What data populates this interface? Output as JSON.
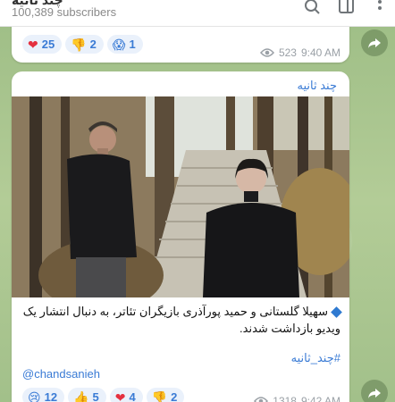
{
  "header": {
    "title": "چند ثانیه",
    "subscribers": "100,389 subscribers"
  },
  "post1": {
    "reactions": [
      {
        "emoji": "❤",
        "count": "25"
      },
      {
        "emoji": "👎",
        "count": "2"
      },
      {
        "emoji": "😱",
        "count": "1"
      }
    ],
    "views": "523",
    "time": "9:40 AM"
  },
  "post2": {
    "channel": "چند ثانیه",
    "caption": "سهیلا گلستانی و حمید پورآذری بازیگران تئاتر، به دنبال انتشار یک ویدیو بازداشت شدند.",
    "hashtag": "#چند_ثانیه",
    "handle": "@chandsanieh",
    "reactions": [
      {
        "emoji": "😢",
        "count": "12"
      },
      {
        "emoji": "👍",
        "count": "5"
      },
      {
        "emoji": "❤",
        "count": "4"
      },
      {
        "emoji": "👎",
        "count": "2"
      }
    ],
    "views": "1318",
    "time": "9:42 AM"
  },
  "icons": {
    "search": "search-icon",
    "columns": "sidebar-toggle-icon",
    "more": "more-vertical-icon",
    "share": "share-arrow-icon",
    "views": "eye-icon"
  },
  "colors": {
    "accent": "#3a7bd5",
    "heart": "#e4303f",
    "background": "#a7c48f"
  }
}
